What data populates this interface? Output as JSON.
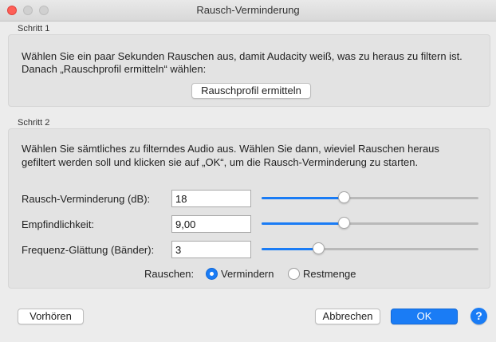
{
  "window": {
    "title": "Rausch-Verminderung"
  },
  "step1": {
    "label": "Schritt 1",
    "line1": "Wählen Sie ein paar Sekunden Rauschen aus, damit Audacity weiß, was zu heraus zu filtern ist.",
    "line2": "Danach „Rauschprofil ermitteln“ wählen:",
    "profile_button": "Rauschprofil ermitteln"
  },
  "step2": {
    "label": "Schritt 2",
    "line1": "Wählen Sie sämtliches zu filterndes Audio aus. Wählen Sie dann, wieviel Rauschen heraus",
    "line2": "gefiltert werden soll und klicken sie auf „OK“, um die Rausch-Verminderung zu starten.",
    "fields": [
      {
        "label": "Rausch-Verminderung (dB):",
        "value": "18",
        "slider_fraction": 0.38
      },
      {
        "label": "Empfindlichkeit:",
        "value": "9,00",
        "slider_fraction": 0.38
      },
      {
        "label": "Frequenz-Glättung (Bänder):",
        "value": "3",
        "slider_fraction": 0.26
      }
    ],
    "noise_label": "Rauschen:",
    "options": [
      {
        "label": "Vermindern",
        "selected": true
      },
      {
        "label": "Restmenge",
        "selected": false
      }
    ]
  },
  "buttons": {
    "preview": "Vorhören",
    "cancel": "Abbrechen",
    "ok": "OK",
    "help": "?"
  },
  "colors": {
    "accent": "#1a7cf5",
    "close": "#fe5f57"
  }
}
